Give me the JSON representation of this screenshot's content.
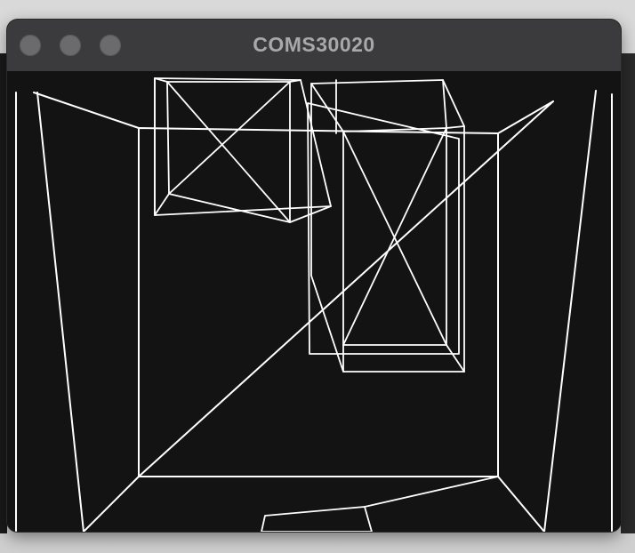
{
  "window": {
    "title": "COMS30020"
  },
  "controls": {
    "close": "close",
    "minimize": "minimize",
    "zoom": "zoom"
  },
  "scene": {
    "render_mode": "wireframe",
    "line_color": "#ffffff",
    "background_color": "#131313"
  }
}
